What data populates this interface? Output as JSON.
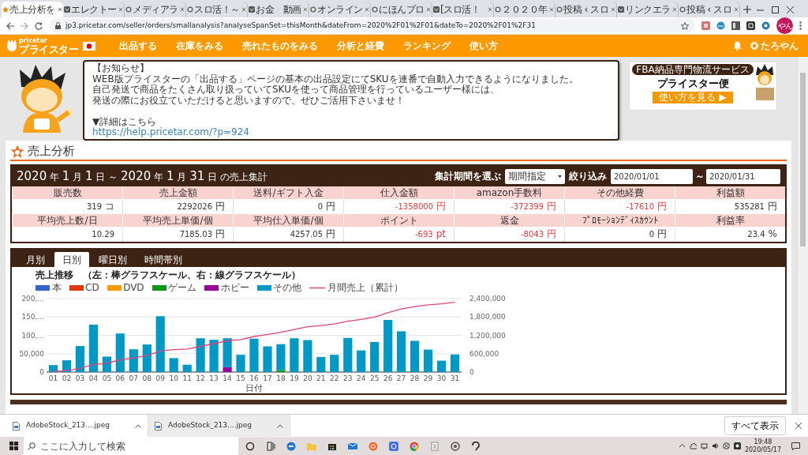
{
  "browser": {
    "tabs": [
      {
        "title": "売上分析を",
        "selected": true
      },
      {
        "title": "エレクトー",
        "selected": false
      },
      {
        "title": "メディアラ",
        "selected": false
      },
      {
        "title": "スロ活！～",
        "selected": false
      },
      {
        "title": "お金　動画",
        "selected": false
      },
      {
        "title": "オンライン",
        "selected": false
      },
      {
        "title": "にほんブロ",
        "selected": false
      },
      {
        "title": "[スロ活！",
        "selected": false
      },
      {
        "title": "２０２０年",
        "selected": false
      },
      {
        "title": "投稿 ‹ スロ",
        "selected": false
      },
      {
        "title": "リンクエラ",
        "selected": false
      },
      {
        "title": "投稿 ‹ スロ",
        "selected": false
      }
    ],
    "address": "jp3.pricetar.com/seller/orders/smallanalysis?analyseSpanSet=thisMonth&dateFrom=2020%2F01%2F01&dateTo=2020%2F01%2F31",
    "profile": "やん"
  },
  "nav": {
    "brand_small": "pricetar",
    "brand": "プライスター",
    "items": [
      "出品する",
      "在庫をみる",
      "売れたものをみる",
      "分析と経費",
      "ランキング",
      "使い方"
    ],
    "user": "たろやん"
  },
  "notice": {
    "lines": [
      "【お知らせ】",
      "WEB版プライスターの「出品する」ページの基本の出品設定にてSKUを連番で自動入力できるようになりました。",
      "自己発送で商品をたくさん取り扱っていてSKUを使って商品管理を行っているユーザー様には、",
      "発送の際にお役立ていただけると思いますので、ぜひご活用下さいませ！"
    ],
    "detail": "▼詳細はこちら",
    "link": "https://help.pricetar.com/?p=924"
  },
  "banner": {
    "tagline": "FBA納品専門物流サービス",
    "name": "プライスター便",
    "button": "使い方を見る ▶"
  },
  "page_title": "売上分析",
  "period": {
    "heading": [
      {
        "text": "2020",
        "kind": "num"
      },
      {
        "text": "年",
        "kind": "unit"
      },
      {
        "text": "1",
        "kind": "num"
      },
      {
        "text": "月",
        "kind": "unit"
      },
      {
        "text": "1",
        "kind": "num"
      },
      {
        "text": "日 ～",
        "kind": "unit"
      },
      {
        "text": "2020",
        "kind": "num"
      },
      {
        "text": "年",
        "kind": "unit"
      },
      {
        "text": "1",
        "kind": "num"
      },
      {
        "text": "月",
        "kind": "unit"
      },
      {
        "text": "31",
        "kind": "num"
      },
      {
        "text": "日",
        "kind": "unit"
      },
      {
        "text": "の売上集計",
        "kind": "unit"
      }
    ],
    "period_label": "集計期間を選ぶ",
    "period_select": "期間指定",
    "filter_label": "絞り込み",
    "date_from": "2020/01/01",
    "separator": "～",
    "date_to": "2020/01/31"
  },
  "summary": [
    [
      {
        "label": "販売数",
        "value": "319",
        "unit": "コ",
        "negative": false
      },
      {
        "label": "売上金額",
        "value": "2292026",
        "unit": "円",
        "negative": false
      },
      {
        "label": "送料/ギフト入金",
        "value": "0",
        "unit": "円",
        "negative": false
      },
      {
        "label": "仕入金額",
        "value": "-1358000",
        "unit": "円",
        "negative": true
      },
      {
        "label": "amazon手数料",
        "value": "-372399",
        "unit": "円",
        "negative": true
      },
      {
        "label": "その他経費",
        "value": "-17610",
        "unit": "円",
        "negative": true
      },
      {
        "label": "利益額",
        "value": "535281",
        "unit": "円",
        "negative": false
      }
    ],
    [
      {
        "label": "平均売上数/日",
        "value": "10.29",
        "negative": false
      },
      {
        "label": "平均売上単価/個",
        "value": "7185.03",
        "unit": "円",
        "negative": false
      },
      {
        "label": "平均仕入単価/個",
        "value": "4257.05",
        "unit": "円",
        "negative": false
      },
      {
        "label": "ポイント",
        "value": "-693",
        "unit": "pt",
        "negative": true
      },
      {
        "label": "返金",
        "value": "-8043",
        "unit": "円",
        "negative": true
      },
      {
        "label": "ﾌﾟﾛﾓｰｼｮﾝﾃﾞｨｽｶｳﾝﾄ",
        "value": "0",
        "unit": "円",
        "negative": false
      },
      {
        "label": "利益率",
        "value": "23.4",
        "unit": "%",
        "negative": false
      }
    ]
  ],
  "tabs": [
    {
      "label": "月別",
      "selected": false
    },
    {
      "label": "日別",
      "selected": true
    },
    {
      "label": "曜日別",
      "selected": false
    },
    {
      "label": "時間帯別",
      "selected": false
    }
  ],
  "chart": {
    "title": "売上推移　（左：棒グラフスケール、右：線グラフスケール）",
    "chart_data": {
      "type": "bar",
      "stacked": true,
      "xlabel": "日付",
      "categories": [
        "01",
        "02",
        "03",
        "04",
        "05",
        "06",
        "07",
        "08",
        "09",
        "10",
        "11",
        "12",
        "13",
        "14",
        "15",
        "16",
        "17",
        "18",
        "19",
        "20",
        "21",
        "22",
        "23",
        "24",
        "25",
        "26",
        "27",
        "28",
        "29",
        "30",
        "31"
      ],
      "ylim": [
        0,
        200000
      ],
      "yticks": [
        {
          "value": 0,
          "label": "0"
        },
        {
          "value": 50000,
          "label": "50,000"
        },
        {
          "value": 100000,
          "label": "100,..."
        },
        {
          "value": 150000,
          "label": "150,..."
        },
        {
          "value": 200000,
          "label": "200,..."
        }
      ],
      "series": [
        {
          "name": "本",
          "color": "#3366cc",
          "values": [
            0,
            0,
            0,
            0,
            0,
            0,
            0,
            0,
            0,
            0,
            0,
            0,
            0,
            0,
            0,
            0,
            0,
            0,
            0,
            0,
            0,
            0,
            0,
            0,
            0,
            0,
            0,
            0,
            0,
            0,
            0
          ]
        },
        {
          "name": "CD",
          "color": "#dc3912",
          "values": [
            0,
            0,
            0,
            0,
            0,
            0,
            0,
            0,
            0,
            0,
            0,
            0,
            0,
            0,
            0,
            0,
            0,
            0,
            0,
            0,
            0,
            0,
            0,
            0,
            0,
            0,
            0,
            0,
            0,
            0,
            0
          ]
        },
        {
          "name": "DVD",
          "color": "#ff9900",
          "values": [
            0,
            0,
            0,
            0,
            0,
            0,
            0,
            0,
            0,
            0,
            0,
            0,
            0,
            0,
            0,
            0,
            0,
            0,
            0,
            0,
            0,
            0,
            0,
            0,
            0,
            0,
            0,
            0,
            0,
            0,
            0
          ]
        },
        {
          "name": "ゲーム",
          "color": "#109618",
          "values": [
            0,
            0,
            0,
            0,
            0,
            0,
            0,
            0,
            0,
            0,
            0,
            0,
            0,
            0,
            0,
            0,
            0,
            5000,
            0,
            0,
            0,
            0,
            0,
            0,
            0,
            0,
            0,
            0,
            0,
            0,
            0
          ]
        },
        {
          "name": "ホビー",
          "color": "#990099",
          "values": [
            0,
            0,
            0,
            0,
            0,
            0,
            0,
            0,
            0,
            0,
            0,
            0,
            0,
            13000,
            0,
            0,
            0,
            0,
            0,
            0,
            0,
            0,
            0,
            0,
            0,
            0,
            0,
            0,
            0,
            0,
            0
          ]
        },
        {
          "name": "その他",
          "color": "#0099c6",
          "values": [
            19000,
            32000,
            71000,
            129000,
            42000,
            105000,
            62000,
            75000,
            152000,
            38000,
            20000,
            92000,
            88000,
            79000,
            47000,
            91000,
            70000,
            71000,
            92000,
            87000,
            41000,
            47000,
            93000,
            59000,
            82000,
            142000,
            111000,
            85000,
            61000,
            31000,
            48000
          ]
        }
      ],
      "grid": true,
      "legend": "top"
    }
  },
  "cumulative_line": {
    "chart_data": {
      "type": "line",
      "ylim": [
        0,
        2400000
      ],
      "yticks": [
        {
          "value": 0,
          "label": "0"
        },
        {
          "value": 600000,
          "label": "600,000"
        },
        {
          "value": 1200000,
          "label": "1,200,000"
        },
        {
          "value": 1800000,
          "label": "1,800,000"
        },
        {
          "value": 2400000,
          "label": "2,400,000"
        }
      ],
      "series": [
        {
          "name": "月間売上（累計）",
          "color": "#dd4477",
          "values": [
            20000,
            50000,
            120000,
            250000,
            290000,
            400000,
            460000,
            540000,
            690000,
            730000,
            750000,
            840000,
            930000,
            1020000,
            1060000,
            1160000,
            1230000,
            1300000,
            1390000,
            1480000,
            1520000,
            1570000,
            1660000,
            1720000,
            1800000,
            1940000,
            2060000,
            2140000,
            2200000,
            2230000,
            2280000
          ]
        }
      ]
    }
  },
  "downloads": {
    "files": [
      "AdobeStock_213....jpeg",
      "AdobeStock_213....jpeg"
    ],
    "show_all": "すべて表示"
  },
  "taskbar": {
    "search_placeholder": "ここに入力して検索",
    "time": "19:48",
    "date": "2020/05/17"
  }
}
